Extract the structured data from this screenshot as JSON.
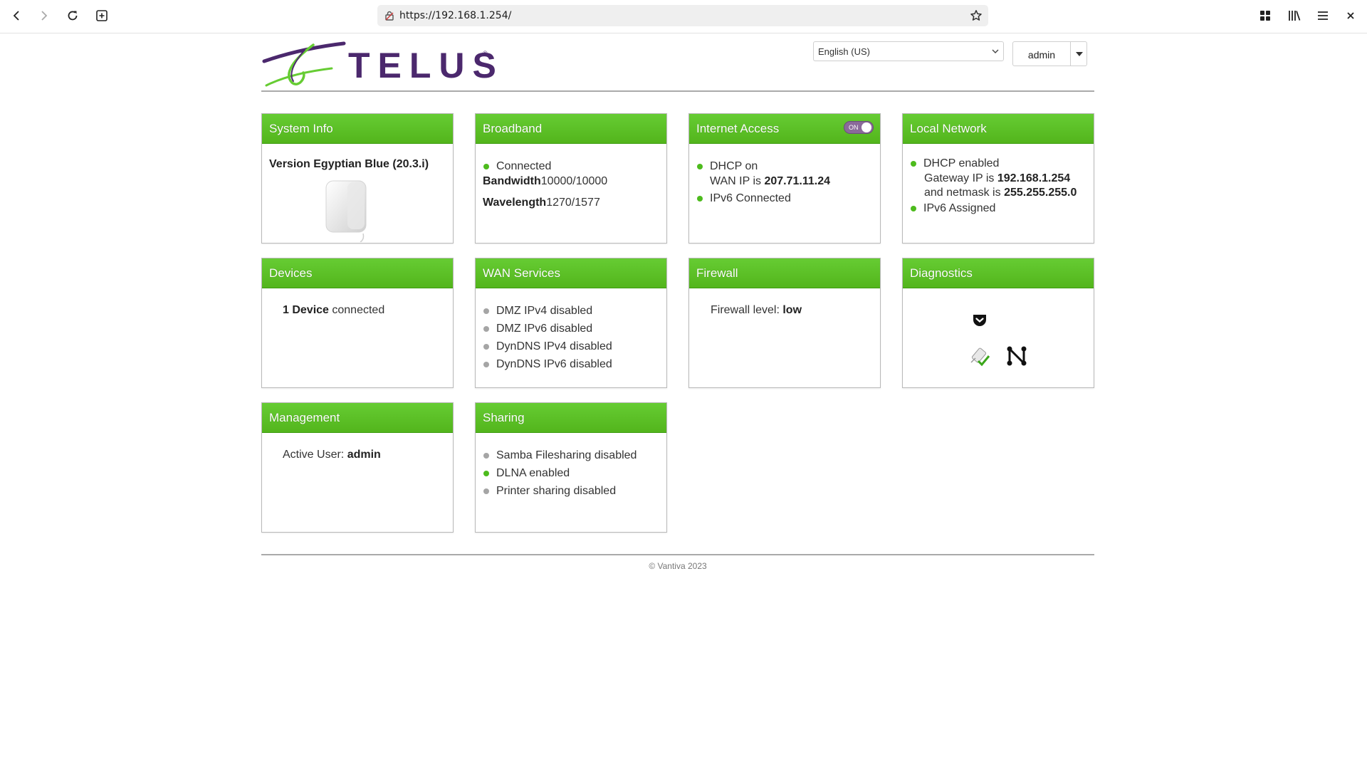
{
  "browser": {
    "url": "https://192.168.1.254/"
  },
  "header": {
    "brand": "TELUS",
    "registered": "®",
    "language": "English (US)",
    "user": "admin"
  },
  "cards": {
    "system_info": {
      "title": "System Info",
      "version": "Version Egyptian Blue (20.3.i)"
    },
    "broadband": {
      "title": "Broadband",
      "status": "Connected",
      "bandwidth_label": "Bandwidth",
      "bandwidth_value": "10000/10000",
      "wavelength_label": "Wavelength",
      "wavelength_value": "1270/1577"
    },
    "internet_access": {
      "title": "Internet Access",
      "toggle_label": "ON",
      "dhcp": "DHCP on",
      "wan_ip_label": "WAN IP is ",
      "wan_ip": "207.71.11.24",
      "ipv6": "IPv6 Connected"
    },
    "local_network": {
      "title": "Local Network",
      "dhcp": "DHCP enabled",
      "gateway_label": "Gateway IP is ",
      "gateway": "192.168.1.254",
      "netmask_label": "and netmask is ",
      "netmask": "255.255.255.0",
      "ipv6": "IPv6 Assigned"
    },
    "devices": {
      "title": "Devices",
      "count": "1 Device",
      "suffix": " connected"
    },
    "wan_services": {
      "title": "WAN Services",
      "items": [
        "DMZ IPv4 disabled",
        "DMZ IPv6 disabled",
        "DynDNS IPv4 disabled",
        "DynDNS IPv6 disabled"
      ]
    },
    "firewall": {
      "title": "Firewall",
      "label": "Firewall level: ",
      "level": "low"
    },
    "diagnostics": {
      "title": "Diagnostics"
    },
    "management": {
      "title": "Management",
      "label": "Active User: ",
      "user": "admin"
    },
    "sharing": {
      "title": "Sharing",
      "items": [
        "Samba Filesharing disabled",
        "DLNA enabled",
        "Printer sharing disabled"
      ]
    }
  },
  "footer": {
    "copyright": "© Vantiva 2023"
  },
  "colors": {
    "header_green": "#66cc33",
    "brand_purple": "#4b286d",
    "status_on": "#4dbb1d",
    "status_off": "#a5a5a5"
  }
}
